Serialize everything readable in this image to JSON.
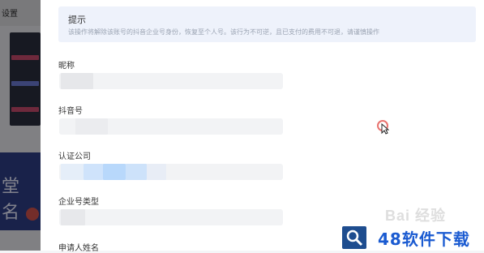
{
  "background": {
    "title": "设置",
    "banner_text": "堂 名"
  },
  "tip": {
    "title": "提示",
    "text": "该操作将解除该账号的抖音企业号身份，恢复至个人号。该行为不可逆，且已支付的费用不可退，请谨慎操作"
  },
  "fields": {
    "nickname": {
      "label": "昵称",
      "value": ""
    },
    "douyin_id": {
      "label": "抖音号",
      "value": ""
    },
    "company": {
      "label": "认证公司",
      "value": ""
    },
    "account_type": {
      "label": "企业号类型",
      "value": ""
    },
    "applicant": {
      "label": "申请人姓名"
    }
  },
  "watermarks": {
    "baidu": "Bai 经验",
    "site": "48软件下载"
  },
  "colors": {
    "tip_bg": "#eef2fb",
    "input_bg": "#f2f3f5",
    "accent_blue": "#1b5bd1"
  }
}
